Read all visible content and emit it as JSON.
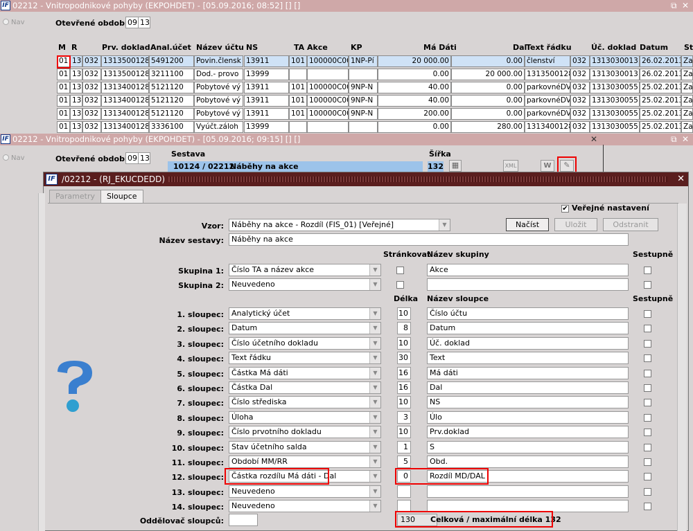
{
  "win1": {
    "title": "02212 - Vnitropodnikové pohyby (EKPOHDET) - [05.09.2016; 08:52]  []  []",
    "nav": "Nav",
    "obdobi_label": "Otevřené období",
    "obdobi_m": "09",
    "obdobi_r": "13",
    "headers": [
      "M",
      "R",
      "Prv. doklad",
      "Anal.účet",
      "Název účtu",
      "NS",
      "TA Akce",
      "KP",
      "Má Dáti",
      "Dal",
      "Text řádku",
      "Úč. doklad",
      "Datum",
      "St."
    ],
    "rows": [
      [
        "01",
        "13",
        "032",
        "1313500128",
        "5491200",
        "Povin.člensk",
        "13911",
        "101",
        "100000C00",
        "1NP-Pí",
        "20 000.00",
        "0.00",
        "členství",
        "032",
        "1313030013",
        "26.02.2013",
        "Za"
      ],
      [
        "01",
        "13",
        "032",
        "1313500128",
        "3211100",
        "Dod.- provo",
        "13999",
        "",
        "",
        "",
        "0.00",
        "20 000.00",
        "1313500128",
        "032",
        "1313030013",
        "26.02.2013",
        "Za"
      ],
      [
        "01",
        "13",
        "032",
        "1313400128",
        "5121120",
        "Pobytové vý",
        "13911",
        "101",
        "100000C00",
        "9NP-N",
        "40.00",
        "0.00",
        "parkovnéDV",
        "032",
        "1313030055",
        "25.02.2013",
        "Za"
      ],
      [
        "01",
        "13",
        "032",
        "1313400128",
        "5121120",
        "Pobytové vý",
        "13911",
        "101",
        "100000C00",
        "9NP-N",
        "40.00",
        "0.00",
        "parkovnéDV",
        "032",
        "1313030055",
        "25.02.2013",
        "Za"
      ],
      [
        "01",
        "13",
        "032",
        "1313400128",
        "5121120",
        "Pobytové vý",
        "13911",
        "101",
        "100000C00",
        "9NP-N",
        "200.00",
        "0.00",
        "parkovnéDV",
        "032",
        "1313030055",
        "25.02.2013",
        "Za"
      ],
      [
        "01",
        "13",
        "032",
        "1313400128",
        "3336100",
        "Vyúčt.záloh",
        "13999",
        "",
        "",
        "",
        "0.00",
        "280.00",
        "1313400128",
        "032",
        "1313030055",
        "25.02.2013",
        "Za"
      ]
    ]
  },
  "win2": {
    "title": "02212 - Vnitropodnikové pohyby (EKPOHDET) - [05.09.2016; 09:15]  []  []",
    "nav": "Nav",
    "obdobi_label": "Otevřené období",
    "obdobi_m": "09",
    "obdobi_r": "13",
    "sestava_label": "Sestava",
    "sirka_label": "Šířka",
    "sestava_code": "10124 / 02212",
    "sestava_name": "Náběhy na akce",
    "sirka": "132"
  },
  "dialog": {
    "title": "/02212 - (RJ_EKUCDEDD)",
    "tabs": [
      "Parametry",
      "Sloupce"
    ],
    "verejne_label": "Veřejné nastavení",
    "vzor_label": "Vzor:",
    "vzor_value": "Náběhy na akce - Rozdíl  (FIS_01)  [Veřejné]",
    "btn_nacist": "Načíst",
    "btn_ulozit": "Uložit",
    "btn_odstranit": "Odstranit",
    "nazev_label": "Název sestavy:",
    "nazev_value": "Náběhy na akce",
    "col_strankovat": "Stránkovat",
    "col_nazev_skupiny": "Název skupiny",
    "col_sestupne": "Sestupně",
    "skupiny": [
      {
        "label": "Skupina 1:",
        "value": "Číslo TA a název akce",
        "name": "Akce"
      },
      {
        "label": "Skupina 2:",
        "value": "Neuvedeno",
        "name": ""
      }
    ],
    "col_delka": "Délka",
    "col_nazev_sloupce": "Název sloupce",
    "col_sestupne2": "Sestupně",
    "sloupce": [
      {
        "label": "1. sloupec:",
        "value": "Analytický účet",
        "len": "10",
        "name": "Číslo účtu"
      },
      {
        "label": "2. sloupec:",
        "value": "Datum",
        "len": "8",
        "name": "Datum"
      },
      {
        "label": "3. sloupec:",
        "value": "Číslo účetního dokladu",
        "len": "10",
        "name": "Úč. doklad"
      },
      {
        "label": "4. sloupec:",
        "value": "Text řádku",
        "len": "30",
        "name": "Text"
      },
      {
        "label": "5. sloupec:",
        "value": "Částka Má dáti",
        "len": "16",
        "name": "Má dáti"
      },
      {
        "label": "6. sloupec:",
        "value": "Částka Dal",
        "len": "16",
        "name": "Dal"
      },
      {
        "label": "7. sloupec:",
        "value": "Číslo střediska",
        "len": "10",
        "name": "NS"
      },
      {
        "label": "8. sloupec:",
        "value": "Úloha",
        "len": "3",
        "name": "Úlo"
      },
      {
        "label": "9. sloupec:",
        "value": "Číslo prvotního dokladu",
        "len": "10",
        "name": "Prv.doklad"
      },
      {
        "label": "10. sloupec:",
        "value": "Stav účetního salda",
        "len": "1",
        "name": "S"
      },
      {
        "label": "11. sloupec:",
        "value": "Období MM/RR",
        "len": "5",
        "name": "Obd."
      },
      {
        "label": "12. sloupec:",
        "value": "Částka rozdílu Má dáti - Dal",
        "len": "0",
        "name": "Rozdíl MD/DAL"
      },
      {
        "label": "13. sloupec:",
        "value": "Neuvedeno",
        "len": "",
        "name": ""
      },
      {
        "label": "14. sloupec:",
        "value": "Neuvedeno",
        "len": "",
        "name": ""
      }
    ],
    "oddelovac_label": "Oddělovač sloupců:",
    "total_value": "130",
    "total_label": "Celková / maximální délka 132"
  },
  "colors": {
    "accent": "#e00000",
    "title_active": "#5a1e1e",
    "title_inactive": "#cfa8a8"
  }
}
